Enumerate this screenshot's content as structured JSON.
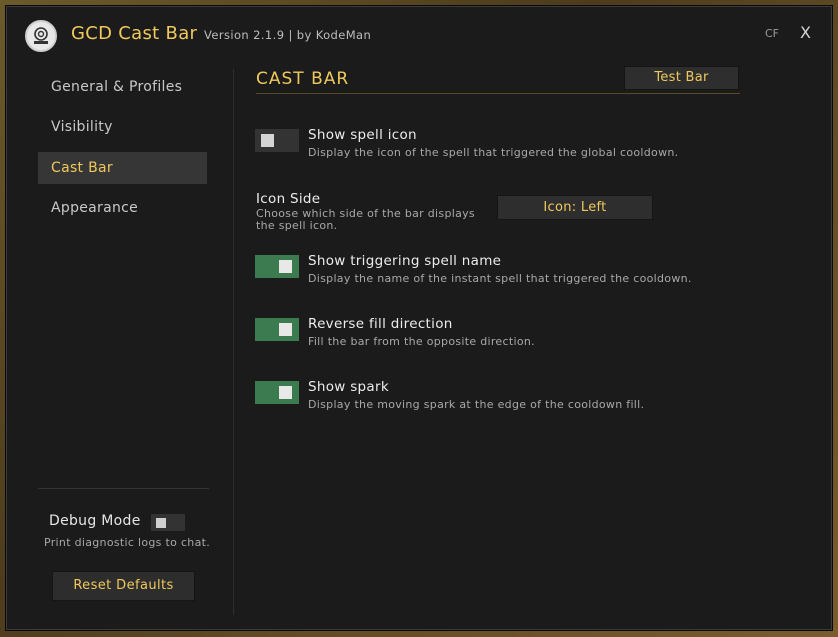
{
  "header": {
    "title": "GCD Cast Bar",
    "meta": "Version 2.1.9  |  by KodeMan",
    "cf_label": "CF",
    "close_label": "X"
  },
  "sidebar": {
    "items": [
      {
        "label": "General & Profiles",
        "active": false
      },
      {
        "label": "Visibility",
        "active": false
      },
      {
        "label": "Cast Bar",
        "active": true
      },
      {
        "label": "Appearance",
        "active": false
      }
    ],
    "debug": {
      "label": "Debug Mode",
      "description": "Print diagnostic logs to chat.",
      "enabled": false
    },
    "reset_label": "Reset Defaults"
  },
  "main": {
    "section_title": "CAST BAR",
    "test_button_label": "Test Bar",
    "options": [
      {
        "label": "Show spell icon",
        "description": "Display the icon of the spell that triggered the global cooldown.",
        "enabled": false
      },
      {
        "label": "Show triggering spell name",
        "description": "Display the name of the instant spell that triggered the cooldown.",
        "enabled": true
      },
      {
        "label": "Reverse fill direction",
        "description": "Fill the bar from the opposite direction.",
        "enabled": true
      },
      {
        "label": "Show spark",
        "description": "Display the moving spark at the edge of the cooldown fill.",
        "enabled": true
      }
    ],
    "icon_side": {
      "label": "Icon Side",
      "description": "Choose which side of the bar displays the spell icon.",
      "value": "Icon: Left"
    }
  },
  "colors": {
    "accent": "#f0c95c",
    "toggle_on": "#3c7a4f",
    "toggle_off": "#333333",
    "panel_bg": "#1b1b1b"
  }
}
